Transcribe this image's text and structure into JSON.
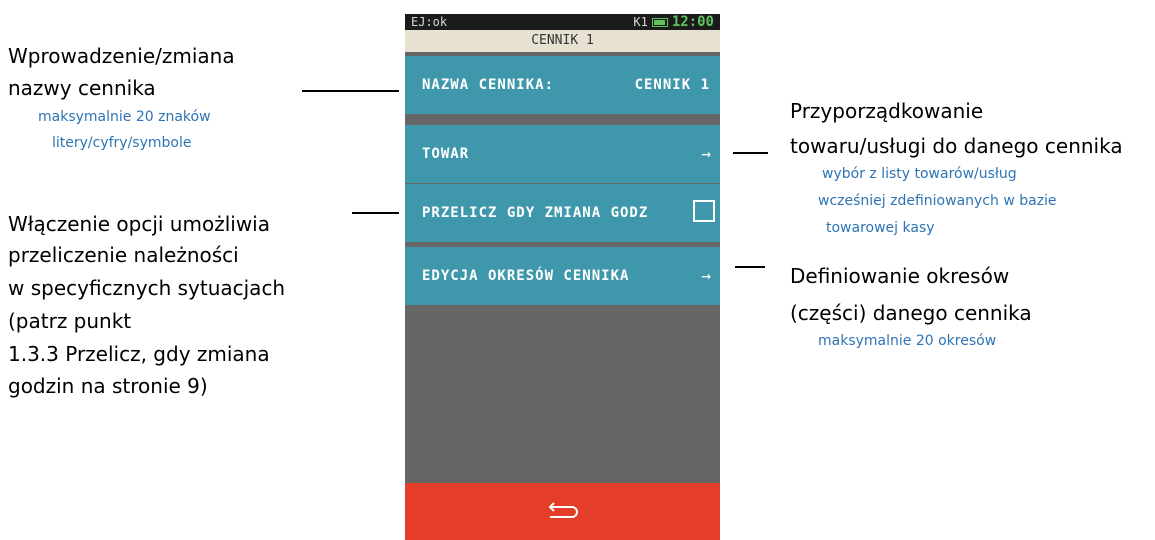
{
  "annotations": {
    "left_top": {
      "lines": [
        "Wprowadzenie/zmiana",
        "nazwy cennika"
      ],
      "sub": [
        "maksymalnie 20 znaków",
        "litery/cyfry/symbole"
      ]
    },
    "left_bottom": {
      "lines": [
        "Włączenie opcji umożliwia",
        "przeliczenie należności",
        "w specyficznych sytuacjach",
        "(patrz punkt",
        "1.3.3 Przelicz, gdy zmiana",
        "godzin na stronie 9)"
      ]
    },
    "right_top": {
      "lines": [
        "Przyporządkowanie",
        "towaru/usługi do danego cennika"
      ],
      "sub": [
        "wybór z listy towarów/usług",
        " wcześniej  zdefiniowanych w bazie",
        "towarowej kasy"
      ]
    },
    "right_bottom": {
      "lines": [
        "Definiowanie okresów",
        "(części) danego cennika"
      ],
      "sub": [
        "maksymalnie 20 okresów"
      ]
    }
  },
  "device": {
    "status_left": "EJ:ok",
    "status_k": "K1",
    "clock": "12:00",
    "battery_level": 0.9,
    "title": "CENNIK 1",
    "menu": {
      "name_label": "NAZWA CENNIKA:",
      "name_value": "CENNIK 1",
      "towar_label": "TOWAR",
      "towar_arrow": "→",
      "przelicz_label": "PRZELICZ GDY ZMIANA GODZ",
      "przelicz_checked": false,
      "okresy_label": "EDYCJA OKRESÓW CENNIKA",
      "okresy_arrow": "→"
    },
    "back_icon": "back-arrow-icon"
  },
  "colors": {
    "menu_bg": "#3f97ac",
    "screen_bg": "#666666",
    "bottom_bar": "#e43d29",
    "title_bar": "#e6e1d0",
    "clock": "#62c25c",
    "annotation_sub": "#2e74b5"
  }
}
